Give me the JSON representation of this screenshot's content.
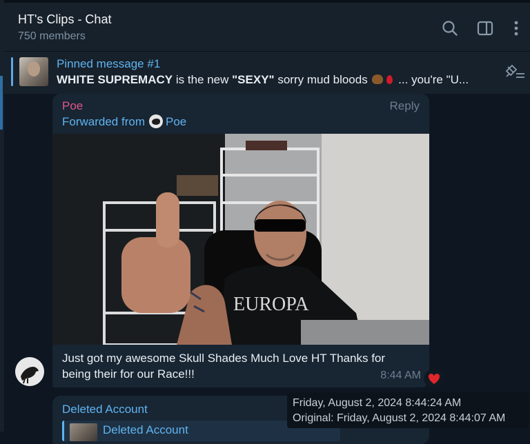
{
  "header": {
    "title": "HT's Clips - Chat",
    "subtitle": "750 members",
    "icons": [
      "search-icon",
      "sidebar-toggle-icon",
      "more-vertical-icon"
    ]
  },
  "pinned": {
    "title": "Pinned message #1",
    "text_bold_1": "WHITE SUPREMACY",
    "text_1": " is the new ",
    "text_bold_2": "\"SEXY\"",
    "text_2": " sorry mud bloods ",
    "text_3": " ... you're \"U...",
    "emojis": [
      "pile-of-poo",
      "drop-of-blood"
    ]
  },
  "message": {
    "sender": "Poe",
    "reply_label": "Reply",
    "forwarded_label": "Forwarded from",
    "forwarded_from": "Poe",
    "photo_shirt_text": "EUROPA",
    "caption": "Just got my awesome Skull Shades Much Love HT Thanks for being their for our Race!!!",
    "time": "8:44 AM",
    "reaction": "heart"
  },
  "message2": {
    "sender": "Deleted Account",
    "reply_sender": "Deleted Account"
  },
  "tooltip": {
    "line1": "Friday, August 2, 2024 8:44:24 AM",
    "line2": "Original: Friday, August 2, 2024 8:44:07 AM"
  },
  "colors": {
    "background": "#0e1621",
    "panel": "#17212b",
    "bubble": "#182533",
    "accent_blue": "#5fb4f0",
    "sender_pink": "#e0578b",
    "muted": "#6d7f90",
    "heart": "#e0262b"
  }
}
